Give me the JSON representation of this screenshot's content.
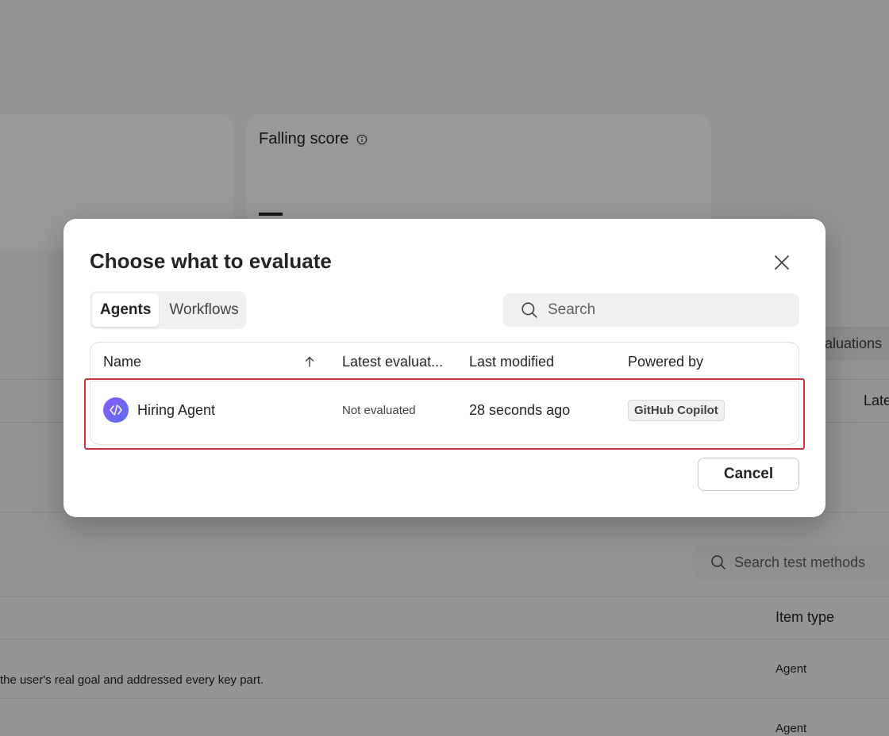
{
  "background": {
    "falling_score_title": "Falling score",
    "evaluations_pill": "valuations",
    "latest_cutoff": "Late",
    "search_placeholder": "Search test methods",
    "item_type_header": "Item type",
    "row1_description": "the user's real goal and addressed every key part.",
    "row1_type": "Agent",
    "row2_type": "Agent"
  },
  "dialog": {
    "title": "Choose what to evaluate",
    "tabs": [
      {
        "label": "Agents",
        "selected": true
      },
      {
        "label": "Workflows",
        "selected": false
      }
    ],
    "search_placeholder": "Search",
    "table": {
      "headers": {
        "name": "Name",
        "latest_evaluation": "Latest evaluat...",
        "last_modified": "Last modified",
        "powered_by": "Powered by"
      },
      "rows": [
        {
          "name": "Hiring Agent",
          "latest_evaluation": "Not evaluated",
          "last_modified": "28 seconds ago",
          "powered_by": "GitHub Copilot"
        }
      ]
    },
    "cancel_label": "Cancel"
  },
  "colors": {
    "highlight_border": "#d13438",
    "avatar_gradient_start": "#8b5cf6",
    "avatar_gradient_end": "#5b6cf0"
  },
  "icons": {
    "close": "close-icon",
    "search": "search-icon",
    "sort": "arrow-up-icon",
    "info": "info-icon",
    "agent_avatar": "code-icon"
  }
}
